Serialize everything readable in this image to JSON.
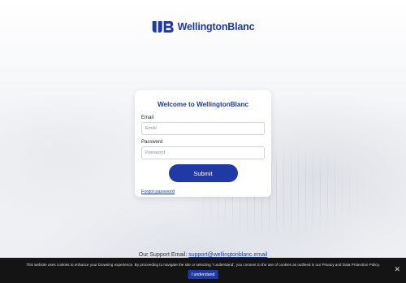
{
  "brand": {
    "name": "WellingtonBlanc",
    "logo_icon": "wb-monogram-icon",
    "color": "#1f3aa6"
  },
  "login": {
    "title": "Welcome to WellingtonBlanc",
    "email_label": "Email",
    "email_placeholder": "Email",
    "password_label": "Password",
    "password_placeholder": "Password",
    "submit_label": "Submit",
    "forgot_label": "Forgot password"
  },
  "support": {
    "prefix": "Our Support Email: ",
    "email": "support@wellingtonblanc.email"
  },
  "cookie_banner": {
    "text": "This website uses cookies to enhance your browsing experience. By proceeding to navigate the site or selecting 'I understand', you consent to the use of cookies as outlined in our Privacy and Data Protection Policy.",
    "button_label": "I understand",
    "close_glyph": "✕"
  }
}
